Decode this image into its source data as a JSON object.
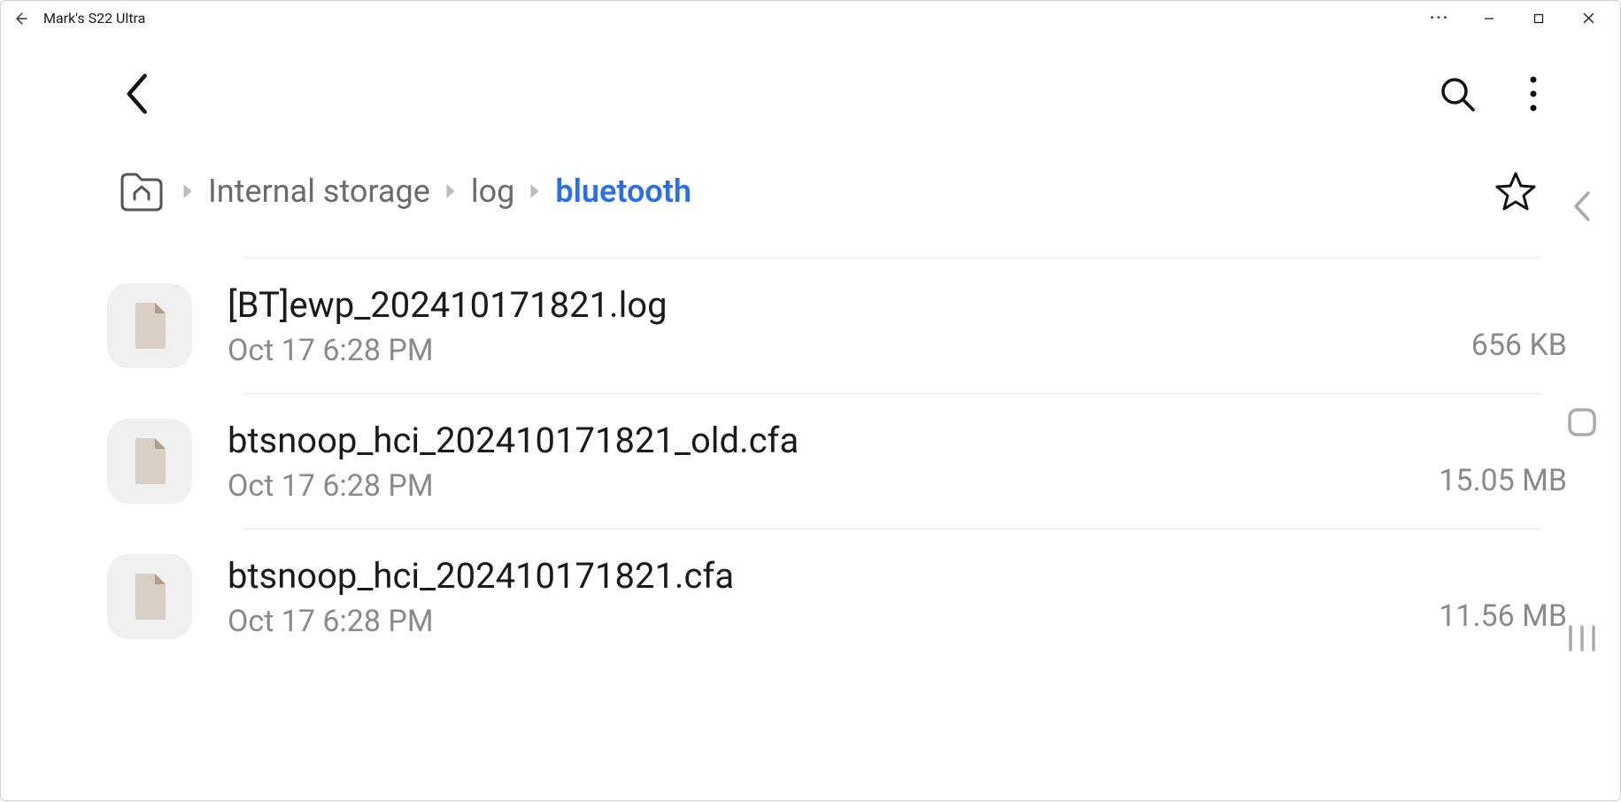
{
  "window": {
    "title": "Mark's S22 Ultra"
  },
  "breadcrumb": {
    "items": [
      {
        "label": "Internal storage",
        "active": false
      },
      {
        "label": "log",
        "active": false
      },
      {
        "label": "bluetooth",
        "active": true
      }
    ]
  },
  "files": [
    {
      "name": "[BT]ewp_202410171821.log",
      "date": "Oct 17 6:28 PM",
      "size": "656 KB"
    },
    {
      "name": "btsnoop_hci_202410171821_old.cfa",
      "date": "Oct 17 6:28 PM",
      "size": "15.05 MB"
    },
    {
      "name": "btsnoop_hci_202410171821.cfa",
      "date": "Oct 17 6:28 PM",
      "size": "11.56 MB"
    }
  ]
}
